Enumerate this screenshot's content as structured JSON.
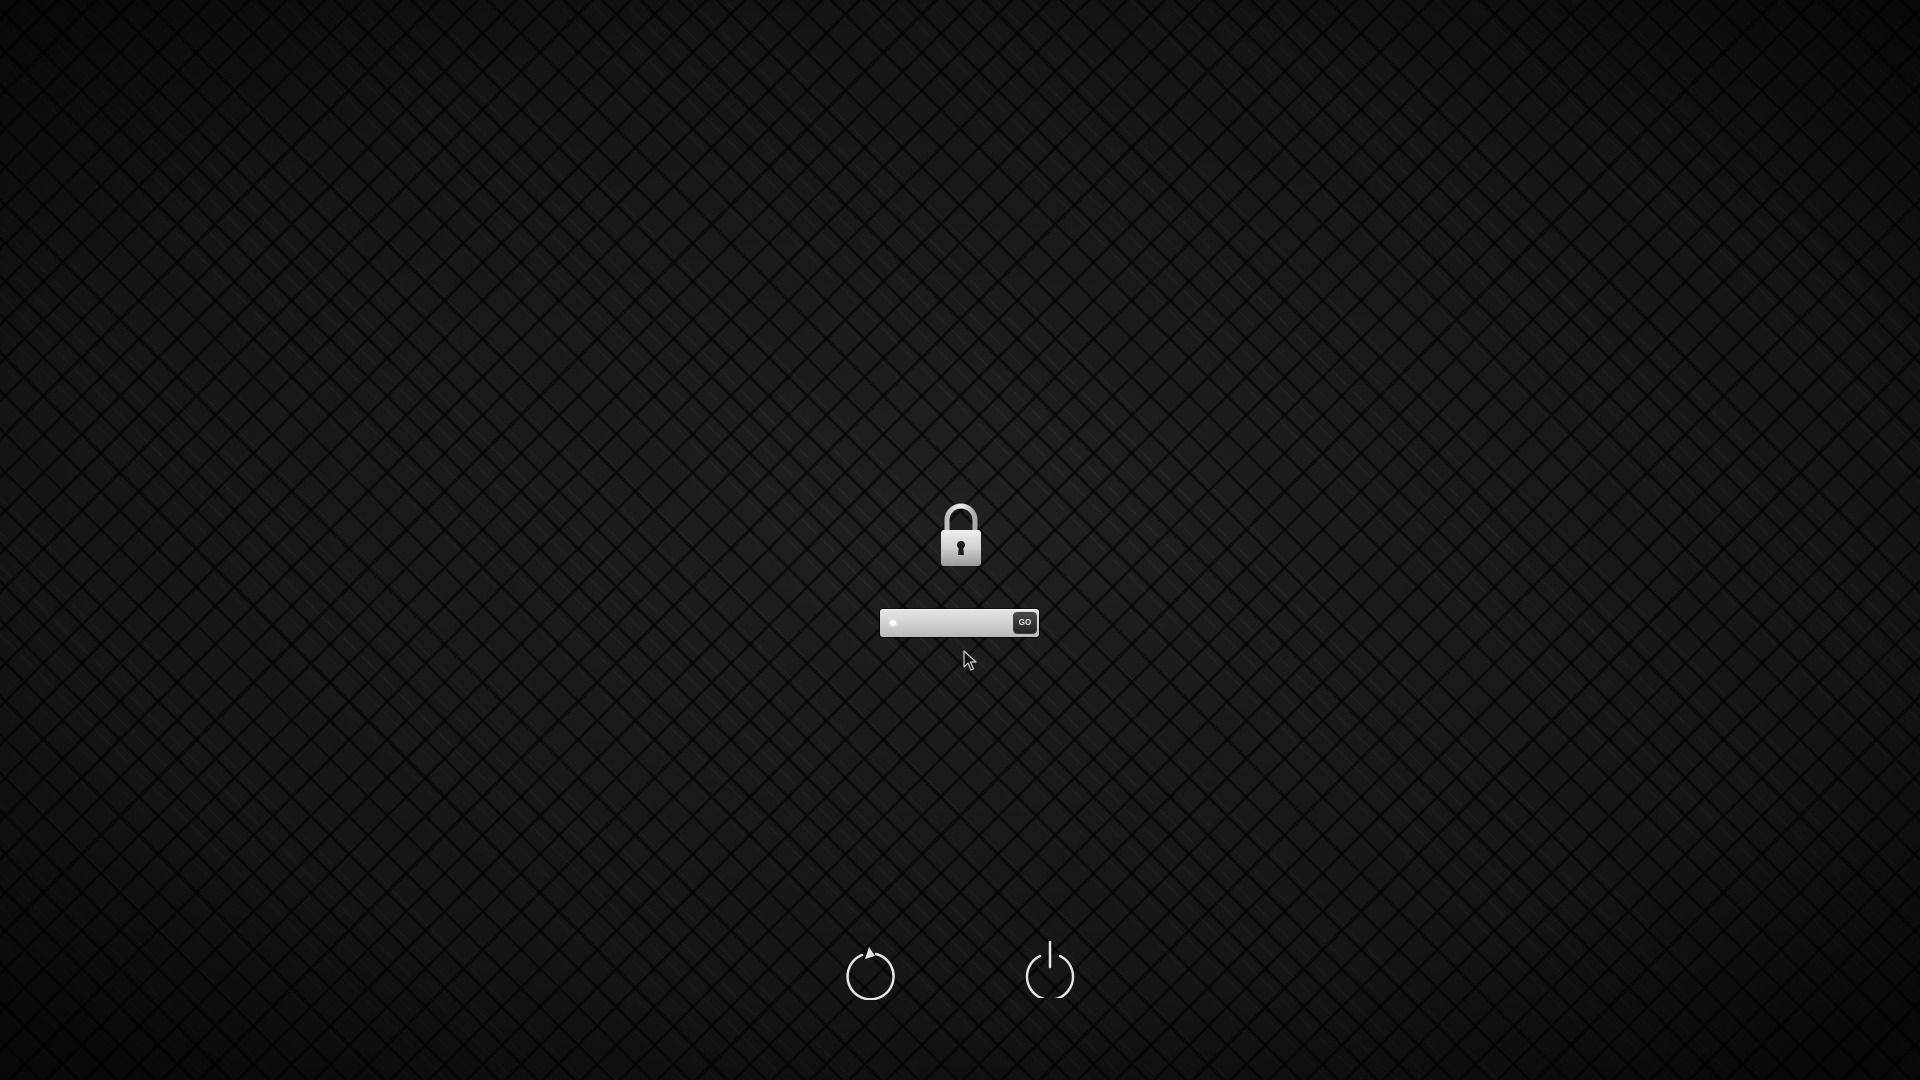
{
  "login": {
    "go_label": "GO",
    "password_placeholder": ""
  },
  "icons": {
    "lock": "lock-icon",
    "restart": "restart-icon",
    "shutdown": "power-icon",
    "cursor": "mouse-pointer-icon"
  },
  "colors": {
    "background": "#202020",
    "field": "#d2d2d2",
    "go_button": "#2e2e2e",
    "icon": "#e0e0e0"
  }
}
